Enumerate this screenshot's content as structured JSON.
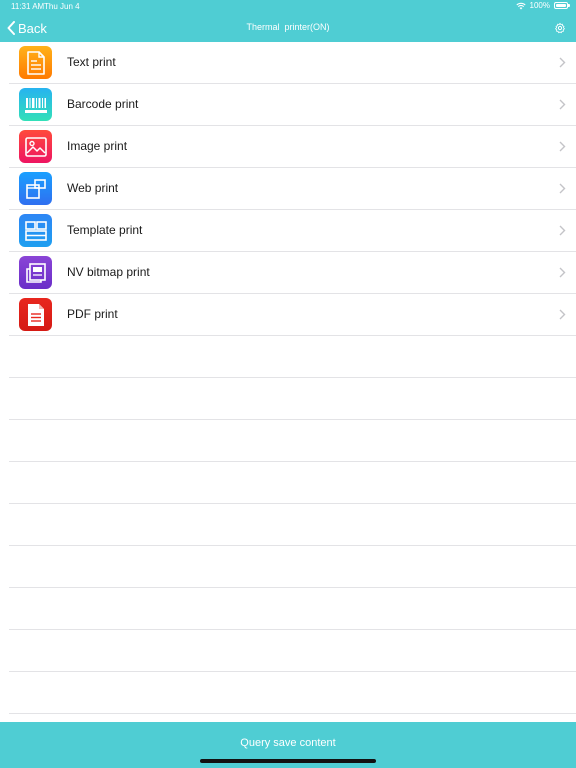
{
  "status": {
    "time": "11:31 AM",
    "date": "Thu Jun 4",
    "battery": "100%"
  },
  "nav": {
    "back_label": "Back",
    "title": "Thermal  printer(ON)"
  },
  "menu": [
    {
      "label": "Text print",
      "icon": "text-document-icon",
      "colors": [
        "#ffb21a",
        "#ff7a00"
      ]
    },
    {
      "label": "Barcode print",
      "icon": "barcode-icon",
      "colors": [
        "#27b3f0",
        "#32e0b8"
      ]
    },
    {
      "label": "Image print",
      "icon": "image-icon",
      "colors": [
        "#ff4a3b",
        "#ee1562"
      ]
    },
    {
      "label": "Web print",
      "icon": "web-window-icon",
      "colors": [
        "#1aa0ff",
        "#2f6ff0"
      ]
    },
    {
      "label": "Template print",
      "icon": "template-icon",
      "colors": [
        "#2e86f5",
        "#1e9ff0"
      ]
    },
    {
      "label": "NV bitmap print",
      "icon": "bitmap-icon",
      "colors": [
        "#8b45d6",
        "#6a2dc8"
      ]
    },
    {
      "label": "PDF print",
      "icon": "pdf-icon",
      "colors": [
        "#e8271e",
        "#d51a14"
      ]
    }
  ],
  "footer": {
    "label": "Query save content"
  },
  "theme": {
    "accent": "#4fcdd3"
  }
}
